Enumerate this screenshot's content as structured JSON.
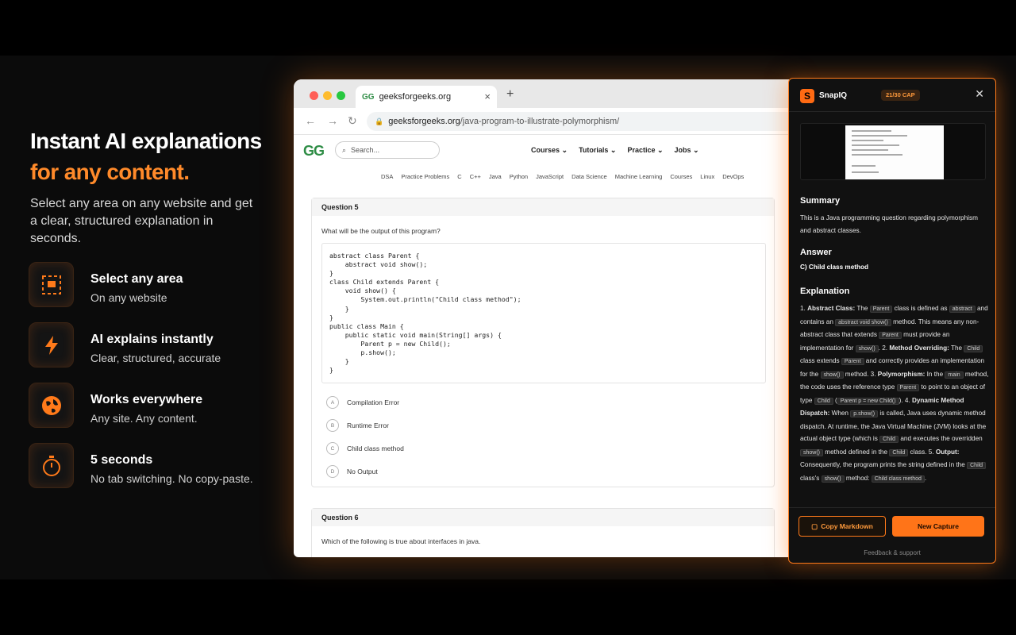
{
  "hero": {
    "title_line1": "Instant AI explanations",
    "title_line2": "for any content.",
    "subtitle": "Select any area on any website and get a clear, structured explanation in seconds."
  },
  "features": [
    {
      "title": "Select any area",
      "subtitle": "On any website",
      "icon": "selection-icon"
    },
    {
      "title": "AI explains instantly",
      "subtitle": "Clear, structured, accurate",
      "icon": "lightning-icon"
    },
    {
      "title": "Works everywhere",
      "subtitle": "Any site. Any content.",
      "icon": "globe-icon"
    },
    {
      "title": "5 seconds",
      "subtitle": "No tab switching. No copy-paste.",
      "icon": "stopwatch-icon"
    }
  ],
  "browser": {
    "tab_title": "geeksforgeeks.org",
    "url_domain": "geeksforgeeks.org",
    "url_path": "/java-program-to-illustrate-polymorphism/",
    "search_placeholder": "Search...",
    "menu": [
      "Courses",
      "Tutorials",
      "Practice",
      "Jobs"
    ],
    "subnav": [
      "DSA",
      "Practice Problems",
      "C",
      "C++",
      "Java",
      "Python",
      "JavaScript",
      "Data Science",
      "Machine Learning",
      "Courses",
      "Linux",
      "DevOps"
    ],
    "q5": {
      "header": "Question 5",
      "text": "What will be the output of this program?",
      "code": "abstract class Parent {\n    abstract void show();\n}\nclass Child extends Parent {\n    void show() {\n        System.out.println(\"Child class method\");\n    }\n}\npublic class Main {\n    public static void main(String[] args) {\n        Parent p = new Child();\n        p.show();\n    }\n}",
      "options": [
        {
          "letter": "A",
          "label": "Compilation Error"
        },
        {
          "letter": "B",
          "label": "Runtime Error"
        },
        {
          "letter": "C",
          "label": "Child class method"
        },
        {
          "letter": "D",
          "label": "No Output"
        }
      ]
    },
    "q6": {
      "header": "Question 6",
      "text": "Which of the following is true about interfaces in java."
    }
  },
  "panel": {
    "name": "SnapIQ",
    "cap": "21/30 CAP",
    "summary_heading": "Summary",
    "summary": "This is a Java programming question regarding polymorphism and abstract classes.",
    "answer_heading": "Answer",
    "answer": "C) Child class method",
    "explanation_heading": "Explanation",
    "copy_label": "Copy Markdown",
    "new_label": "New Capture",
    "feedback": "Feedback & support"
  },
  "colors": {
    "accent": "#ff7418",
    "accent_text": "#ff8a2a",
    "gfg_green": "#2f8d46"
  }
}
